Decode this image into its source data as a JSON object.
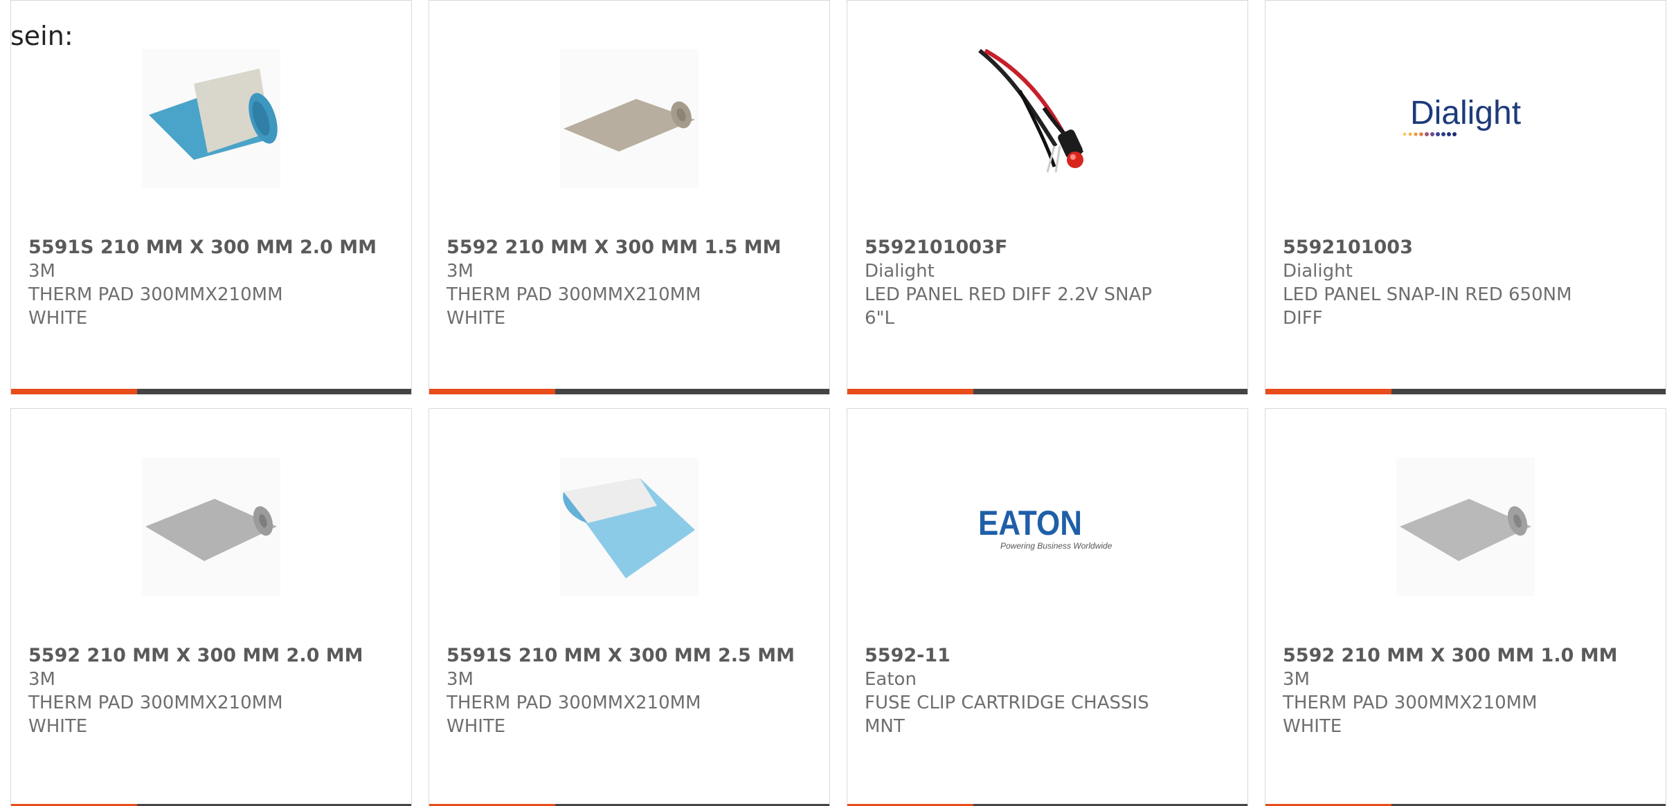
{
  "intro_text": "sein:",
  "colors": {
    "accent": "#e84c1a",
    "bar_dark": "#444444",
    "text": "#6e6e6e"
  },
  "products": [
    {
      "part": "5591S 210 MM X 300 MM 2.0 MM",
      "manufacturer": "3M",
      "description": "THERM PAD 300MMX210MM WHITE",
      "image": "thermal-pad-blue-rolled-icon"
    },
    {
      "part": "5592 210 MM X 300 MM 1.5 MM",
      "manufacturer": "3M",
      "description": "THERM PAD 300MMX210MM WHITE",
      "image": "thermal-pad-gray-rolled-icon"
    },
    {
      "part": "5592101003F",
      "manufacturer": "Dialight",
      "description": "LED PANEL RED DIFF 2.2V SNAP 6\"L",
      "image": "led-wired-icon"
    },
    {
      "part": "5592101003",
      "manufacturer": "Dialight",
      "description": "LED PANEL SNAP-IN RED 650NM DIFF",
      "image": "dialight-logo",
      "logo_text": "Dialight"
    },
    {
      "part": "5592 210 MM X 300 MM 2.0 MM",
      "manufacturer": "3M",
      "description": "THERM PAD 300MMX210MM WHITE",
      "image": "thermal-pad-gray-rolled-icon"
    },
    {
      "part": "5591S 210 MM X 300 MM 2.5 MM",
      "manufacturer": "3M",
      "description": "THERM PAD 300MMX210MM WHITE",
      "image": "thermal-pad-lightblue-icon"
    },
    {
      "part": "5592-11",
      "manufacturer": "Eaton",
      "description": "FUSE CLIP CARTRIDGE CHASSIS MNT",
      "image": "eaton-logo",
      "logo_text": "EATON",
      "logo_tagline": "Powering Business Worldwide"
    },
    {
      "part": "5592 210 MM X 300 MM 1.0 MM",
      "manufacturer": "3M",
      "description": "THERM PAD 300MMX210MM WHITE",
      "image": "thermal-pad-gray-rolled-icon"
    }
  ]
}
